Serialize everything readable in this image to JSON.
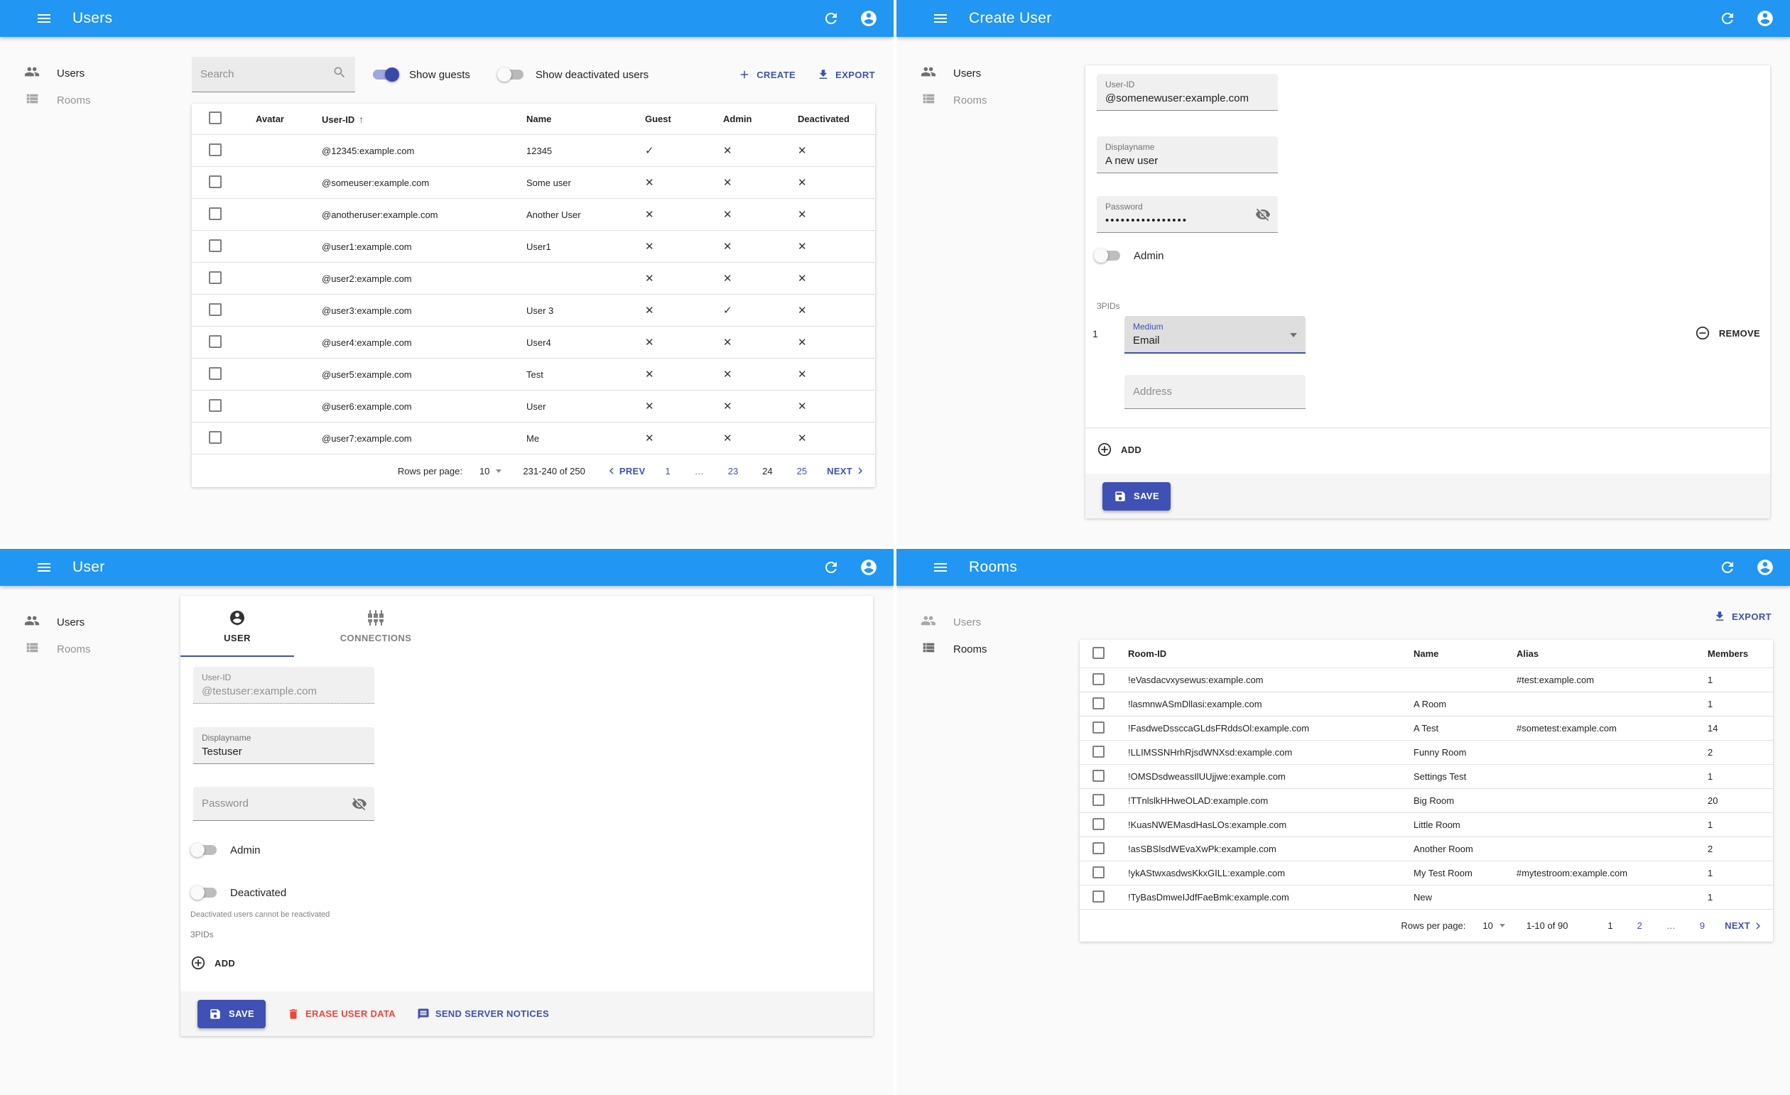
{
  "nav": {
    "users": "Users",
    "rooms": "Rooms"
  },
  "glyphs": {
    "yes": "✓",
    "no": "✕"
  },
  "colors": {
    "appbar": "#2196f3",
    "primary": "#3f51b5",
    "danger": "#f44336"
  },
  "users_list": {
    "title": "Users",
    "active_nav": "users",
    "search_placeholder": "Search",
    "show_guests_label": "Show guests",
    "show_guests_on": true,
    "show_deactivated_label": "Show deactivated users",
    "show_deactivated_on": false,
    "create_label": "CREATE",
    "export_label": "EXPORT",
    "table": {
      "headers": {
        "avatar": "Avatar",
        "user_id": "User-ID",
        "sort": "↑",
        "name": "Name",
        "guest": "Guest",
        "admin": "Admin",
        "deactivated": "Deactivated"
      },
      "rows": [
        {
          "user_id": "@12345:example.com",
          "name": "12345",
          "guest": true,
          "admin": false,
          "deactivated": false
        },
        {
          "user_id": "@someuser:example.com",
          "name": "Some user",
          "guest": false,
          "admin": false,
          "deactivated": false
        },
        {
          "user_id": "@anotheruser:example.com",
          "name": "Another User",
          "guest": false,
          "admin": false,
          "deactivated": false
        },
        {
          "user_id": "@user1:example.com",
          "name": "User1",
          "guest": false,
          "admin": false,
          "deactivated": false
        },
        {
          "user_id": "@user2:example.com",
          "name": "",
          "guest": false,
          "admin": false,
          "deactivated": false
        },
        {
          "user_id": "@user3:example.com",
          "name": "User 3",
          "guest": false,
          "admin": true,
          "deactivated": false
        },
        {
          "user_id": "@user4:example.com",
          "name": "User4",
          "guest": false,
          "admin": false,
          "deactivated": false
        },
        {
          "user_id": "@user5:example.com",
          "name": "Test",
          "guest": false,
          "admin": false,
          "deactivated": false
        },
        {
          "user_id": "@user6:example.com",
          "name": "User",
          "guest": false,
          "admin": false,
          "deactivated": false
        },
        {
          "user_id": "@user7:example.com",
          "name": "Me",
          "guest": false,
          "admin": false,
          "deactivated": false
        }
      ]
    },
    "pagination": {
      "rows_per_page_label": "Rows per page:",
      "rows_per_page": "10",
      "range": "231-240 of 250",
      "prev_label": "PREV",
      "next_label": "NEXT",
      "pages": [
        {
          "label": "1"
        },
        {
          "label": "…",
          "ellipsis": true
        },
        {
          "label": "23"
        },
        {
          "label": "24",
          "current": true
        },
        {
          "label": "25"
        }
      ]
    }
  },
  "create_user": {
    "title": "Create User",
    "active_nav": "users",
    "form": {
      "user_id": {
        "label": "User-ID",
        "value": "@somenewuser:example.com"
      },
      "displayname": {
        "label": "Displayname",
        "value": "A new user"
      },
      "password": {
        "label": "Password",
        "value": "••••••••••••••••"
      },
      "admin_label": "Admin",
      "admin_on": false,
      "threepids_label": "3PIDs",
      "threepid_index": "1",
      "medium": {
        "label": "Medium",
        "value": "Email"
      },
      "address_placeholder": "Address",
      "remove_label": "REMOVE",
      "add_label": "ADD",
      "save_label": "SAVE"
    }
  },
  "user_edit": {
    "title": "User",
    "active_nav": "users",
    "tabs": [
      {
        "label": "USER",
        "active": true
      },
      {
        "label": "CONNECTIONS",
        "active": false
      }
    ],
    "form": {
      "user_id": {
        "label": "User-ID",
        "value": "@testuser:example.com",
        "disabled": true
      },
      "displayname": {
        "label": "Displayname",
        "value": "Testuser"
      },
      "password_placeholder": "Password",
      "admin_label": "Admin",
      "admin_on": false,
      "deactivated_label": "Deactivated",
      "deactivated_on": false,
      "deactivated_helper": "Deactivated users cannot be reactivated",
      "threepids_label": "3PIDs",
      "add_label": "ADD"
    },
    "footer": {
      "save_label": "SAVE",
      "erase_label": "ERASE USER DATA",
      "notices_label": "SEND SERVER NOTICES"
    }
  },
  "rooms_list": {
    "title": "Rooms",
    "active_nav": "rooms",
    "export_label": "EXPORT",
    "table": {
      "headers": {
        "room_id": "Room-ID",
        "name": "Name",
        "alias": "Alias",
        "members": "Members"
      },
      "rows": [
        {
          "room_id": "!eVasdacvxysewus:example.com",
          "name": "",
          "alias": "#test:example.com",
          "members": "1"
        },
        {
          "room_id": "!lasmnwASmDllasi:example.com",
          "name": "A Room",
          "alias": "",
          "members": "1"
        },
        {
          "room_id": "!FasdweDssccaGLdsFRddsOl:example.com",
          "name": "A Test",
          "alias": "#sometest:example.com",
          "members": "14"
        },
        {
          "room_id": "!LLIMSSNHrhRjsdWNXsd:example.com",
          "name": "Funny Room",
          "alias": "",
          "members": "2"
        },
        {
          "room_id": "!OMSDsdweassIlUUjjwe:example.com",
          "name": "Settings Test",
          "alias": "",
          "members": "1"
        },
        {
          "room_id": "!TTnlslkHHweOLAD:example.com",
          "name": "Big Room",
          "alias": "",
          "members": "20"
        },
        {
          "room_id": "!KuasNWEMasdHasLOs:example.com",
          "name": "Little Room",
          "alias": "",
          "members": "1"
        },
        {
          "room_id": "!asSBSlsdWEvaXwPk:example.com",
          "name": "Another Room",
          "alias": "",
          "members": "2"
        },
        {
          "room_id": "!ykAStwxasdwsKkxGILL:example.com",
          "name": "My Test Room",
          "alias": "#mytestroom:example.com",
          "members": "1"
        },
        {
          "room_id": "!TyBasDmweIJdfFaeBmk:example.com",
          "name": "New",
          "alias": "",
          "members": "1"
        }
      ]
    },
    "pagination": {
      "rows_per_page_label": "Rows per page:",
      "rows_per_page": "10",
      "range": "1-10 of 90",
      "next_label": "NEXT",
      "pages": [
        {
          "label": "1",
          "current": true
        },
        {
          "label": "2"
        },
        {
          "label": "…",
          "ellipsis": true
        },
        {
          "label": "9"
        }
      ]
    }
  }
}
